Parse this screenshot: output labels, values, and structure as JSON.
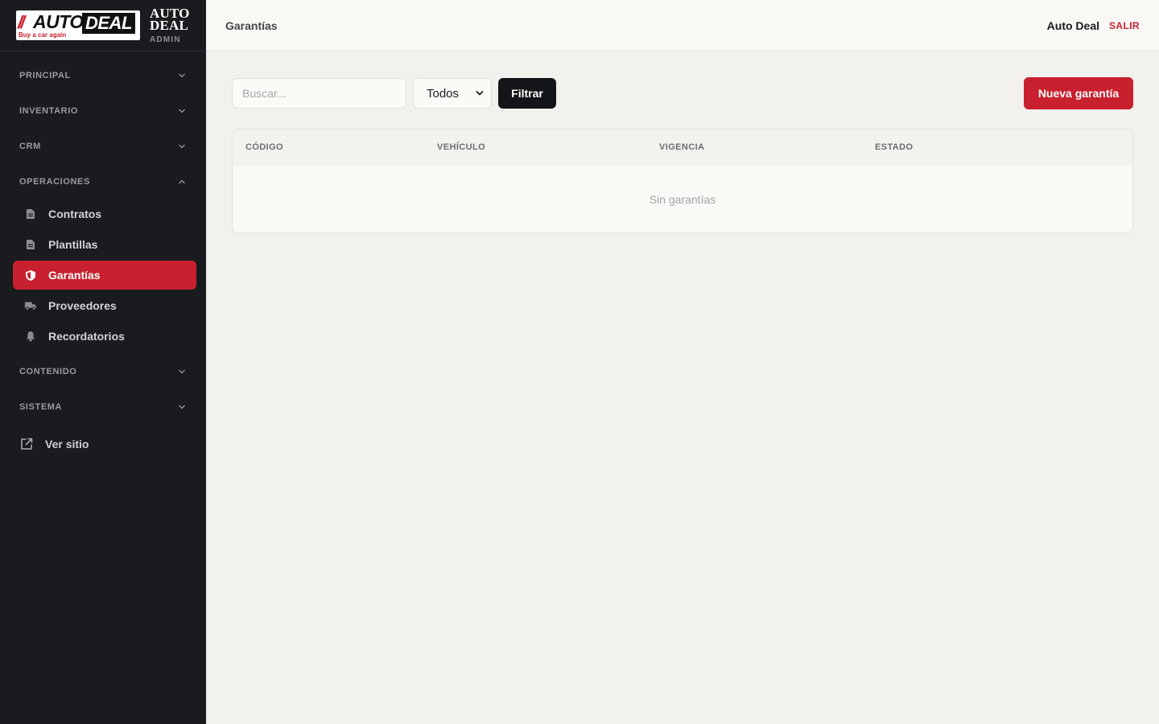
{
  "brand": {
    "logo_slash": "//",
    "logo_auto": "AUTO",
    "logo_deal": "DEAL",
    "logo_tagline": "Buy a car again",
    "title_line1": "AUTO",
    "title_line2": "DEAL",
    "subtitle": "ADMIN"
  },
  "sidebar": {
    "sections": [
      {
        "label": "PRINCIPAL",
        "expanded": false
      },
      {
        "label": "INVENTARIO",
        "expanded": false
      },
      {
        "label": "CRM",
        "expanded": false
      },
      {
        "label": "OPERACIONES",
        "expanded": true
      },
      {
        "label": "CONTENIDO",
        "expanded": false
      },
      {
        "label": "SISTEMA",
        "expanded": false
      }
    ],
    "operaciones_items": [
      {
        "label": "Contratos",
        "icon": "file-icon",
        "active": false
      },
      {
        "label": "Plantillas",
        "icon": "file-icon",
        "active": false
      },
      {
        "label": "Garantías",
        "icon": "shield-icon",
        "active": true
      },
      {
        "label": "Proveedores",
        "icon": "truck-icon",
        "active": false
      },
      {
        "label": "Recordatorios",
        "icon": "bell-icon",
        "active": false
      }
    ],
    "ver_sitio": "Ver sitio"
  },
  "header": {
    "page_title": "Garantías",
    "user_name": "Auto Deal",
    "logout_label": "SALIR"
  },
  "toolbar": {
    "search_placeholder": "Buscar...",
    "status_select": "Todos",
    "filter_label": "Filtrar",
    "new_label": "Nueva garantía"
  },
  "table": {
    "columns": [
      "CÓDIGO",
      "VEHÍCULO",
      "VIGENCIA",
      "ESTADO"
    ],
    "rows": [],
    "empty_message": "Sin garantías"
  },
  "colors": {
    "accent": "#c8202e",
    "sidebar_bg": "#1a1b1f",
    "page_bg": "#f2f1ed"
  }
}
